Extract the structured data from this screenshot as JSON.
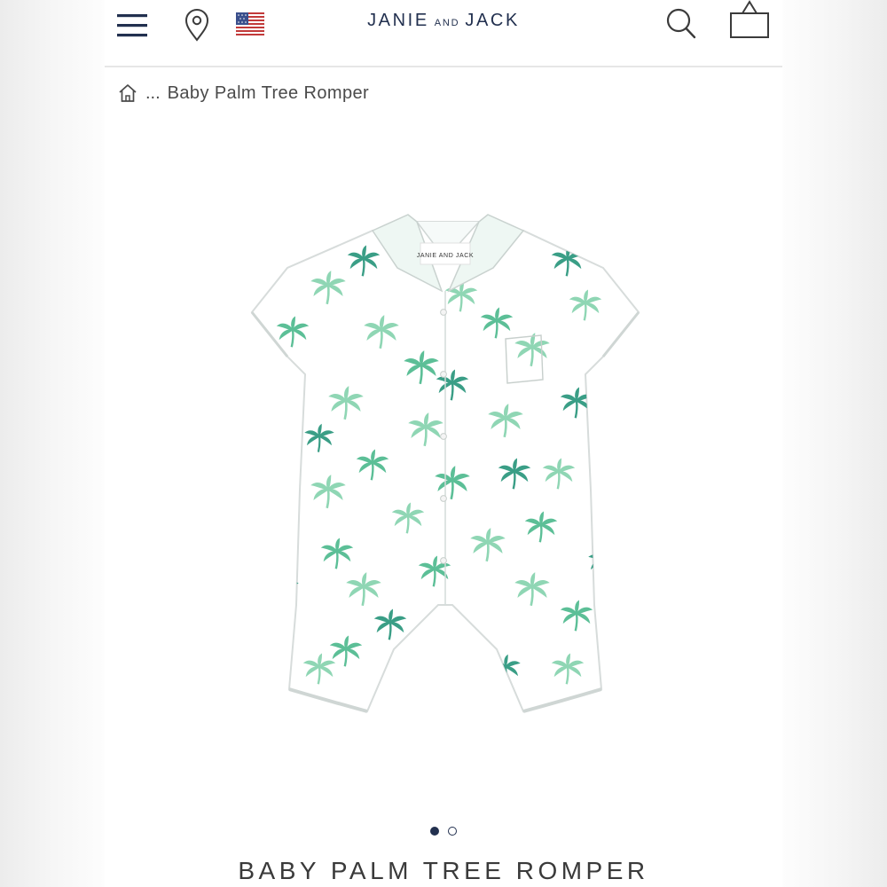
{
  "header": {
    "brand_left": "JANIE",
    "brand_middle": "AND",
    "brand_right": "JACK",
    "menu_icon": "hamburger-menu-icon",
    "location_icon": "map-pin-icon",
    "country_icon": "us-flag-icon",
    "search_icon": "search-icon",
    "bag_icon": "shopping-bag-icon"
  },
  "breadcrumb": {
    "home_icon": "home-icon",
    "ellipsis": "...",
    "current": "Baby Palm Tree Romper"
  },
  "gallery": {
    "image_count": 2,
    "active_index": 0,
    "garment_label_text": "JANIE AND JACK"
  },
  "product": {
    "title": "BABY PALM TREE ROMPER"
  },
  "colors": {
    "brand_navy": "#22304f",
    "palm_light": "#8fd6b4",
    "palm_mid": "#5cbf97",
    "palm_dark": "#3a9e86"
  }
}
